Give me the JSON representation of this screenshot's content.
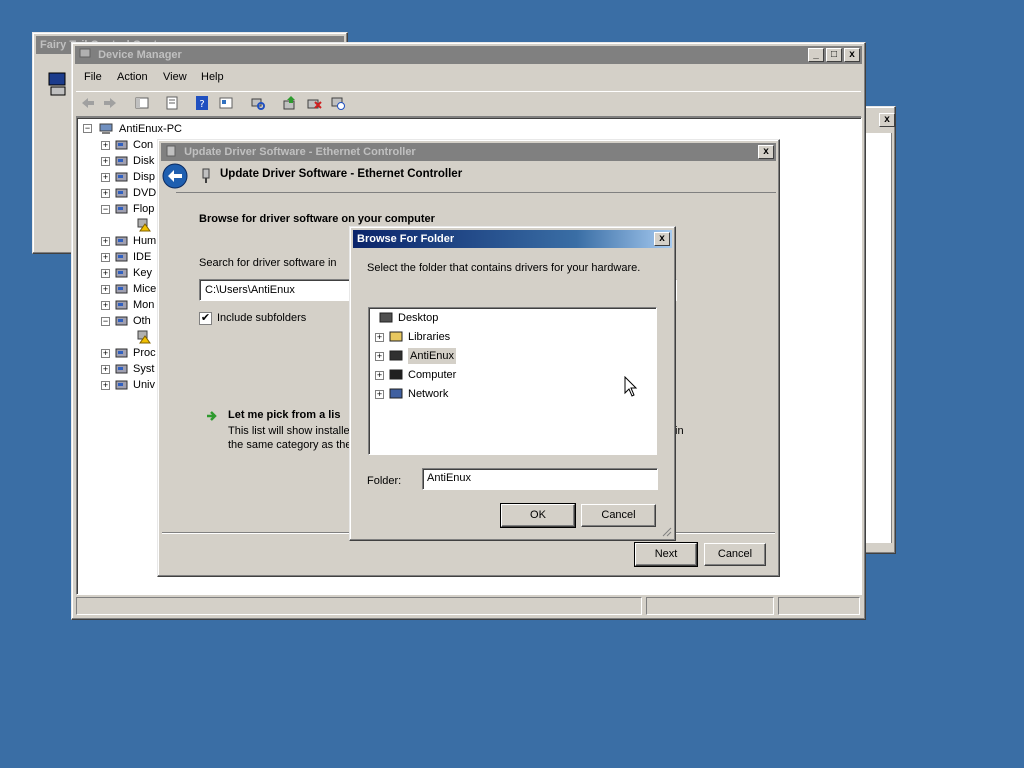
{
  "background_window": {
    "title": "Fairy Tail Control Center",
    "buttons": [
      "minimize",
      "maximize",
      "close"
    ]
  },
  "device_manager": {
    "title": "Device Manager",
    "menu": [
      "File",
      "Action",
      "View",
      "Help"
    ],
    "tree_root": "AntiEnux-PC",
    "tree_items": [
      "Con",
      "Disk",
      "Disp",
      "DVD",
      "Flop",
      "Hum",
      "IDE",
      "Key",
      "Mice",
      "Mon",
      "Oth",
      "Proc",
      "Syst",
      "Univ"
    ],
    "icons": [
      "back-icon",
      "forward-icon",
      "show-hide-icon",
      "properties-icon",
      "help-icon",
      "console-tree-icon",
      "scan-hardware-icon",
      "update-driver-icon",
      "uninstall-icon",
      "disable-icon"
    ]
  },
  "update_driver": {
    "title": "Update Driver Software - Ethernet Controller",
    "header": "Update Driver Software - Ethernet Controller",
    "browse_heading": "Browse for driver software on your computer",
    "search_label": "Search for driver software in",
    "path_value": "C:\\Users\\AntiEnux",
    "include_subfolders": "Include subfolders",
    "include_checked": true,
    "pick_heading": "Let me pick from a lis",
    "pick_desc_1": "This list will show installed",
    "pick_desc_1_tail": "in",
    "pick_desc_2": "the same category as the",
    "next": "Next",
    "cancel": "Cancel"
  },
  "browse_folder": {
    "title": "Browse For Folder",
    "instruction": "Select the folder that contains drivers for your hardware.",
    "tree": [
      "Desktop",
      "Libraries",
      "AntiEnux",
      "Computer",
      "Network"
    ],
    "selected": "AntiEnux",
    "folder_label": "Folder:",
    "folder_value": "AntiEnux",
    "ok": "OK",
    "cancel": "Cancel"
  },
  "colors": {
    "desktop": "#3a6ea5",
    "active_title": "#0a246a",
    "face": "#d4d0c8",
    "green_arrow": "#2e9a2e"
  }
}
